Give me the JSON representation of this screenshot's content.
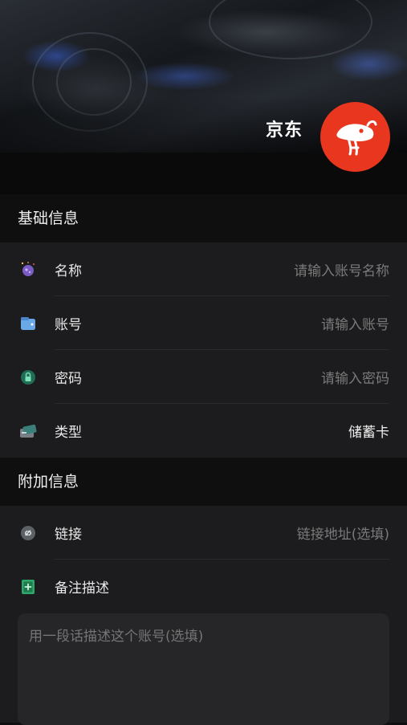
{
  "header": {
    "brand_name": "京东",
    "logo_icon": "jd-dog-logo-icon",
    "logo_color": "#e8361f"
  },
  "sections": {
    "basic_title": "基础信息",
    "extra_title": "附加信息"
  },
  "basic": {
    "name": {
      "label": "名称",
      "placeholder": "请输入账号名称",
      "icon": "planet-icon"
    },
    "account": {
      "label": "账号",
      "placeholder": "请输入账号",
      "icon": "wallet-icon"
    },
    "password": {
      "label": "密码",
      "placeholder": "请输入密码",
      "icon": "lock-icon"
    },
    "type": {
      "label": "类型",
      "value": "储蓄卡",
      "icon": "card-icon"
    }
  },
  "extra": {
    "link": {
      "label": "链接",
      "placeholder": "链接地址(选填)",
      "icon": "link-icon"
    },
    "note": {
      "label": "备注描述",
      "icon": "note-icon"
    },
    "description_placeholder": "用一段话描述这个账号(选填)"
  }
}
